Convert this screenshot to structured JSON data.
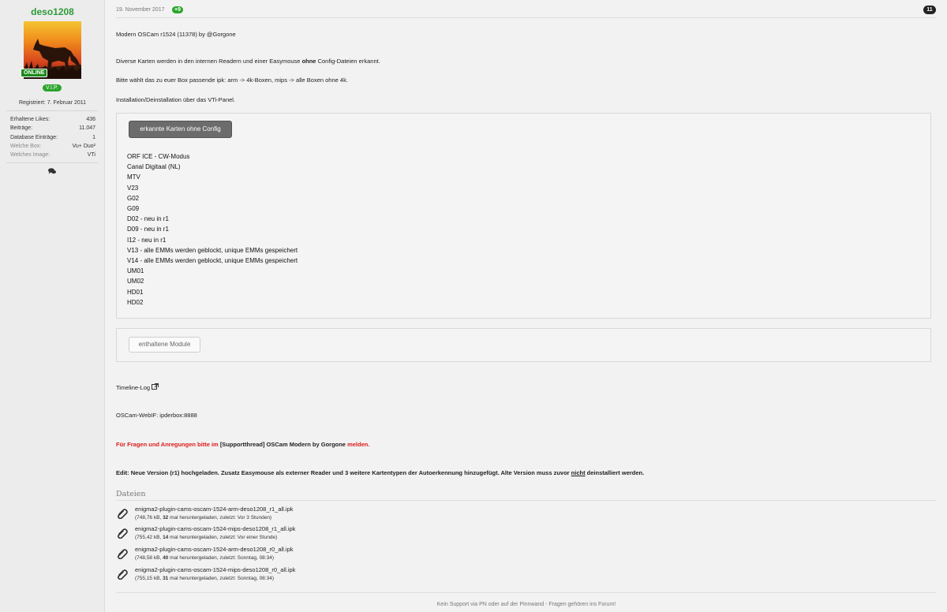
{
  "author": {
    "name": "deso1208",
    "online": "ONLINE",
    "rank": "V.I.P.",
    "registered": "Registriert: 7. Februar 2011",
    "stats": [
      {
        "label": "Erhaltene Likes:",
        "value": "436"
      },
      {
        "label": "Beiträge:",
        "value": "11.047"
      },
      {
        "label": "Database Einträge:",
        "value": "1"
      },
      {
        "label": "Welche Box:",
        "value": "Vu+ Duo²"
      },
      {
        "label": "Welches Image:",
        "value": "VTi"
      }
    ],
    "chat_icon": "comments-icon"
  },
  "post": {
    "date": "19. November 2017",
    "likes": "+9",
    "number": "11",
    "title_line": "Modern OSCam r1524 (11378) by @Gorgone",
    "p1_before": "Diverse Karten werden in den internen Readern und einer Easymouse ",
    "p1_bold": "ohne",
    "p1_after": " Config-Dateien erkannt.",
    "p2": "Bitte wählt das zu euer Box passende ipk: arm -> 4k-Boxen, mips -> alle Boxen ohne 4k.",
    "p3": "Installation/Deinstallation über das VTi-Panel.",
    "spoiler1_label": "erkannte Karten ohne Config",
    "cards": [
      "ORF ICE - CW-Modus",
      "Canal Digitaal (NL)",
      "MTV",
      "V23",
      "G02",
      "G09",
      "D02 - neu in r1",
      "D09 - neu in r1",
      "I12 - neu in r1",
      "V13 - alle EMMs werden geblockt, unique EMMs gespeichert",
      "V14 - alle EMMs werden geblockt, unique EMMs gespeichert",
      "UM01",
      "UM02",
      "HD01",
      "HD02"
    ],
    "spoiler2_label": "enthaltene Module",
    "timeline_link": "Timeline-Log",
    "webif": "OSCam-WebIF: ipderbox:8888",
    "support_red1": "Für Fragen und Anregungen bitte im ",
    "support_link": "[Supportthread] OSCam Modern by Gorgone",
    "support_red2": " melden.",
    "edit_before": "Edit: Neue Version (r1) hochgeladen. Zusatz Easymouse als externer Reader und 3 weitere Kartentypen der Autoerkennung hinzugefügt. Alte Version muss zuvor ",
    "edit_underline": "nicht",
    "edit_after": " deinstalliert werden.",
    "files_title": "Dateien",
    "files": [
      {
        "name": "enigma2-plugin-cams-oscam-1524-arm-deso1208_r1_all.ipk",
        "size": "(748,76 kB, ",
        "count": "32",
        "rest": " mal heruntergeladen, zuletzt: Vor 3 Stunden)"
      },
      {
        "name": "enigma2-plugin-cams-oscam-1524-mips-deso1208_r1_all.ipk",
        "size": "(755,42 kB, ",
        "count": "14",
        "rest": " mal heruntergeladen, zuletzt: Vor einer Stunde)"
      },
      {
        "name": "enigma2-plugin-cams-oscam-1524-arm-deso1208_r0_all.ipk",
        "size": "(748,58 kB, ",
        "count": "40",
        "rest": " mal heruntergeladen, zuletzt: Sonntag, 08:34)"
      },
      {
        "name": "enigma2-plugin-cams-oscam-1524-mips-deso1208_r0_all.ipk",
        "size": "(755,15 kB, ",
        "count": "31",
        "rest": " mal heruntergeladen, zuletzt: Sonntag, 08:34)"
      }
    ],
    "signature": "Kein Support via PN oder auf der Pinnwand - Fragen gehören ins Forum!"
  }
}
